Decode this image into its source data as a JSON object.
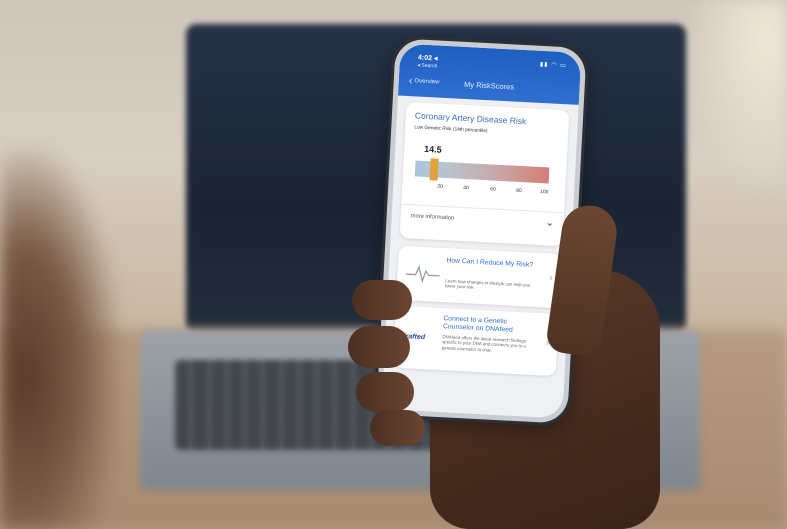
{
  "status_bar": {
    "time": "4:02 ◂",
    "back_app": "◂ Search",
    "icons": "▮▮ ◠ ▭"
  },
  "nav": {
    "back_label": "Overview",
    "title": "My RiskScores"
  },
  "risk_card": {
    "title": "Coronary Artery Disease Risk",
    "subtitle": "Low Genetic Risk (14th percentile)",
    "score": "14.5",
    "score_percentile": 14.5,
    "ticks": [
      "20",
      "40",
      "60",
      "80",
      "100"
    ],
    "more_info": "more information"
  },
  "reduce_card": {
    "title": "How Can I Reduce My Risk?",
    "description": "Learn how changes in lifestyle can help you lower your risk."
  },
  "counsel_card": {
    "logo": "drafted",
    "title": "Connect to a Genetic Counselor on DNAfeed",
    "description": "DNAfeed offers the latest research findings specific to your DNA and connects you to a genetic counselor to chat."
  },
  "colors": {
    "header": "#2f6fd0",
    "accent": "#3a6cc6",
    "marker": "#e2a23a"
  }
}
